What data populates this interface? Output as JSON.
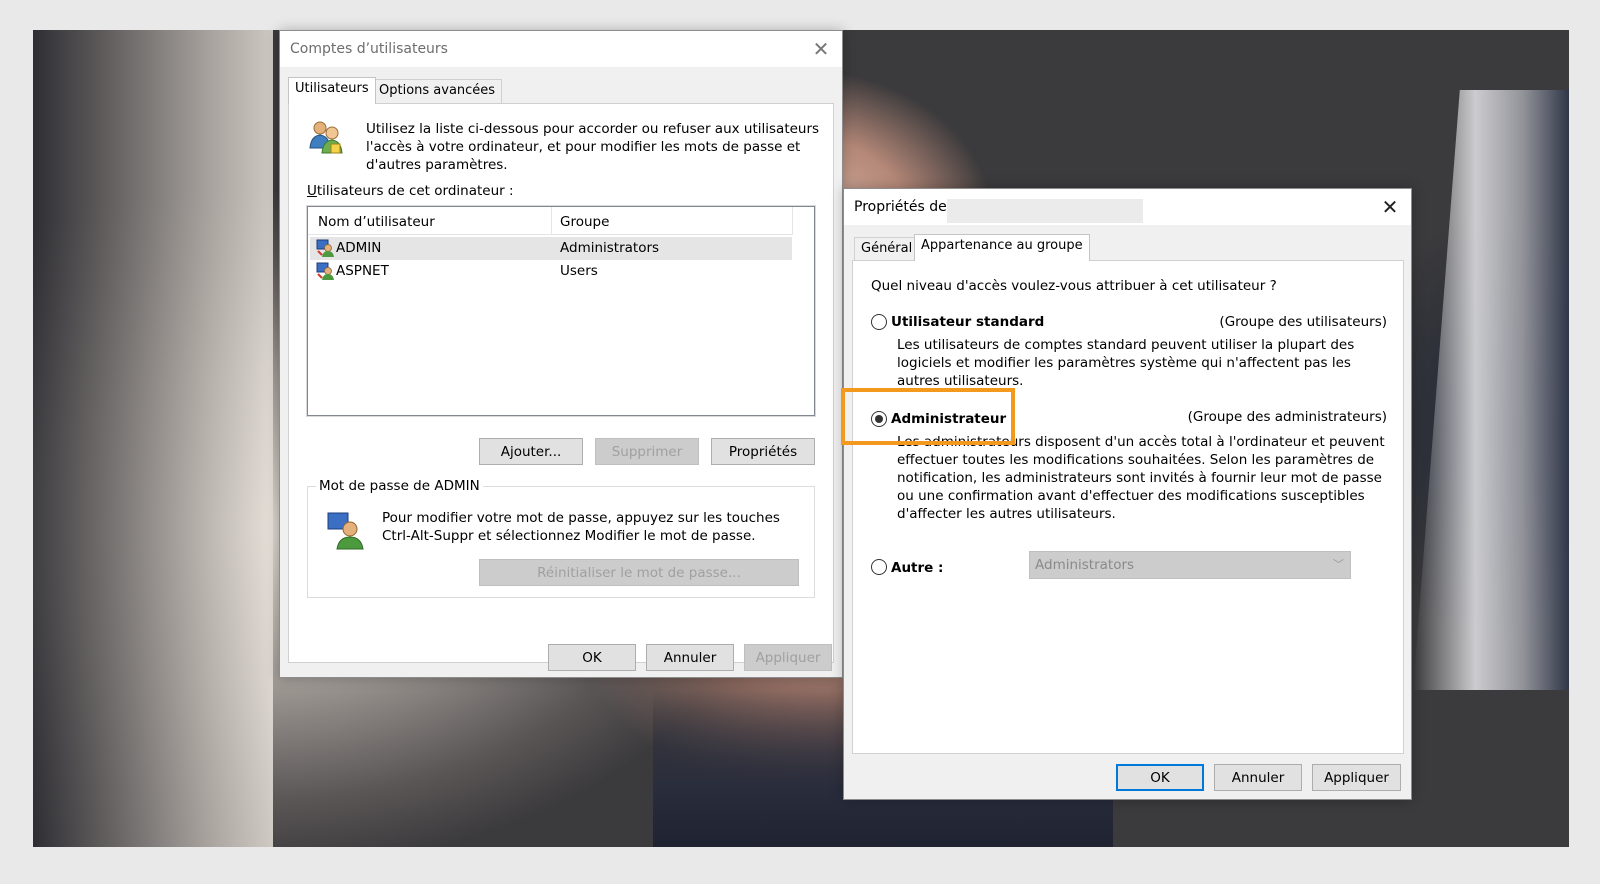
{
  "accounts_dialog": {
    "title": "Comptes d’utilisateurs",
    "tabs": [
      {
        "label": "Utilisateurs"
      },
      {
        "label": "Options avancées"
      }
    ],
    "intro_text": [
      "Utilisez la liste ci-dessous pour accorder ou refuser aux utilisateurs",
      "l'accès à votre ordinateur, et pour modifier les mots de passe et",
      "d'autres paramètres."
    ],
    "users_label": "Utilisateurs de cet ordinateur :",
    "columns": {
      "name": "Nom d’utilisateur",
      "group": "Groupe"
    },
    "rows": [
      {
        "name": "ADMIN",
        "group": "Administrators",
        "selected": true
      },
      {
        "name": "ASPNET",
        "group": "Users",
        "selected": false
      }
    ],
    "buttons": {
      "add": "Ajouter...",
      "remove": "Supprimer",
      "properties": "Propriétés",
      "reset_password": "Réinitialiser le mot de passe...",
      "ok": "OK",
      "cancel": "Annuler",
      "apply": "Appliquer"
    },
    "password_group": {
      "legend": "Mot de passe de ADMIN",
      "text": [
        "Pour modifier votre mot de passe, appuyez sur les touches",
        "Ctrl-Alt-Suppr et sélectionnez Modifier le mot de passe."
      ]
    }
  },
  "properties_dialog": {
    "title": "Propriétés de :",
    "tabs": [
      {
        "label": "Général"
      },
      {
        "label": "Appartenance au groupe"
      }
    ],
    "question": "Quel niveau d'accès voulez-vous attribuer à cet utilisateur ?",
    "options": {
      "standard": {
        "label": "Utilisateur standard",
        "group": "(Groupe des utilisateurs)",
        "description": [
          "Les utilisateurs de comptes standard peuvent utiliser la plupart des",
          "logiciels et modifier les paramètres système qui n'affectent pas les",
          "autres utilisateurs."
        ]
      },
      "admin": {
        "label": "Administrateur",
        "group": "(Groupe des administrateurs)",
        "description": [
          "Les administrateurs disposent d'un accès total à l'ordinateur et peuvent",
          "effectuer toutes les modifications souhaitées. Selon les paramètres de",
          "notification, les administrateurs sont invités à fournir leur mot de passe",
          "ou une confirmation avant d'effectuer des modifications susceptibles",
          "d'affecter les autres utilisateurs."
        ]
      },
      "other": {
        "label": "Autre :",
        "combo_value": "Administrators"
      }
    },
    "selected_option": "admin",
    "buttons": {
      "ok": "OK",
      "cancel": "Annuler",
      "apply": "Appliquer"
    }
  },
  "colors": {
    "highlight": "#f39a1e",
    "focus_border": "#0078d7"
  }
}
